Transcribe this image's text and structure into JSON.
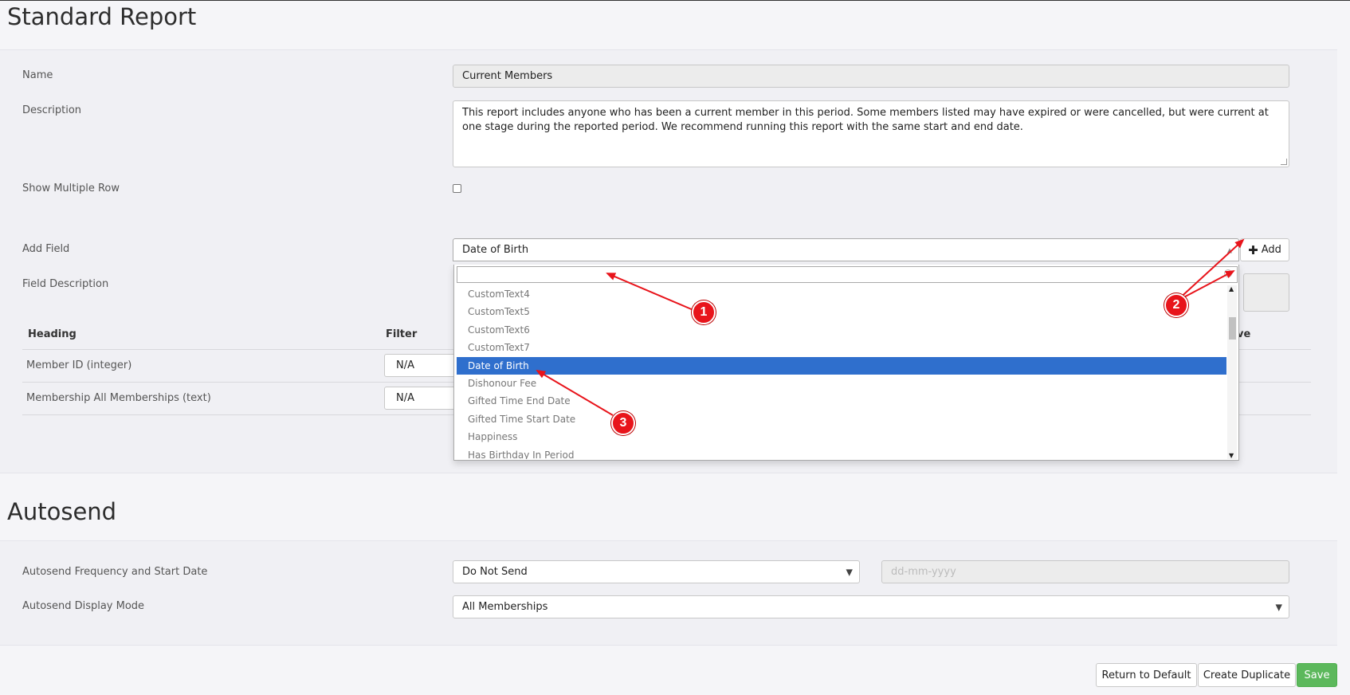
{
  "page": {
    "title": "Standard Report",
    "autosend_title": "Autosend"
  },
  "form": {
    "name_label": "Name",
    "name_value": "Current Members",
    "description_label": "Description",
    "description_value": "This report includes anyone who has been a current member in this period. Some members listed may have expired or were cancelled, but were current at one stage during the reported period. We recommend running this report with the same start and end date.",
    "show_multiple_row_label": "Show Multiple Row",
    "add_field_label": "Add Field",
    "add_field_value": "Date of Birth",
    "add_button_label": "Add",
    "field_description_label": "Field Description"
  },
  "table": {
    "headers": [
      "Heading",
      "Filter",
      "ve"
    ],
    "rows": [
      {
        "heading": "Member ID (integer)",
        "filter": "N/A"
      },
      {
        "heading": "Membership All Memberships (text)",
        "filter": "N/A"
      }
    ]
  },
  "dropdown": {
    "search_value": "",
    "items": [
      {
        "label": "CustomText4",
        "selected": false
      },
      {
        "label": "CustomText5",
        "selected": false
      },
      {
        "label": "CustomText6",
        "selected": false
      },
      {
        "label": "CustomText7",
        "selected": false
      },
      {
        "label": "Date of Birth",
        "selected": true
      },
      {
        "label": "Dishonour Fee",
        "selected": false
      },
      {
        "label": "Gifted Time End Date",
        "selected": false
      },
      {
        "label": "Gifted Time Start Date",
        "selected": false
      },
      {
        "label": "Happiness",
        "selected": false
      },
      {
        "label": "Has Birthday In Period",
        "selected": false
      }
    ]
  },
  "autosend": {
    "frequency_label": "Autosend Frequency and Start Date",
    "frequency_value": "Do Not Send",
    "date_placeholder": "dd-mm-yyyy",
    "display_mode_label": "Autosend Display Mode",
    "display_mode_value": "All Memberships"
  },
  "actions": {
    "return_default": "Return to Default",
    "create_duplicate": "Create Duplicate",
    "save": "Save"
  },
  "annotations": {
    "badge1": "1",
    "badge2": "2",
    "badge3": "3"
  },
  "colors": {
    "selection": "#2f6fcd",
    "save_button": "#5cb85c",
    "annotation": "#e8141b"
  }
}
